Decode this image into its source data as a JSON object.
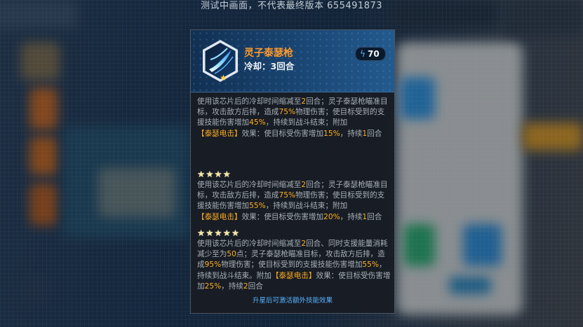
{
  "watermark": "测试中画面，不代表最终版本 655491873",
  "skill": {
    "name": "灵子泰瑟枪",
    "cooldown": "冷却：3回合",
    "cost": "70",
    "icon": "energy-spear-hexagon-icon"
  },
  "tiers": [
    {
      "stars": "",
      "parts": [
        [
          "使用该芯片后的冷却时间缩减至",
          "n"
        ],
        [
          "2",
          "h"
        ],
        [
          "回合；灵子泰瑟枪瞄准目标，攻击敌方后排，造成",
          "n"
        ],
        [
          "75%",
          "h"
        ],
        [
          "物理伤害；使目标受到的支援技能伤害增加",
          "n"
        ],
        [
          "45%",
          "h"
        ],
        [
          "，持续到战斗结束；附加",
          "n"
        ],
        [
          "【泰瑟电击】",
          "e"
        ],
        [
          "效果：使目标受伤害增加",
          "n"
        ],
        [
          "15%",
          "h"
        ],
        [
          "，持续",
          "n"
        ],
        [
          "1",
          "h"
        ],
        [
          "回合",
          "n"
        ]
      ]
    },
    {
      "stars": "★★★★",
      "parts": [
        [
          "使用该芯片后的冷却时间缩减至",
          "n"
        ],
        [
          "2",
          "h"
        ],
        [
          "回合；灵子泰瑟枪瞄准目标，攻击敌方后排，造成",
          "n"
        ],
        [
          "75%",
          "h"
        ],
        [
          "物理伤害；使目标受到的支援技能伤害增加",
          "n"
        ],
        [
          "55%",
          "h"
        ],
        [
          "，持续到战斗结束；附加",
          "n"
        ],
        [
          "【泰瑟电击】",
          "e"
        ],
        [
          "效果：使目标受伤害增加",
          "n"
        ],
        [
          "20%",
          "h"
        ],
        [
          "，持续",
          "n"
        ],
        [
          "1",
          "h"
        ],
        [
          "回合",
          "n"
        ]
      ]
    },
    {
      "stars": "★★★★★",
      "parts": [
        [
          "使用该芯片后的冷却时间缩减至",
          "n"
        ],
        [
          "2",
          "h"
        ],
        [
          "回合、同时支援能量消耗减少至为",
          "n"
        ],
        [
          "50",
          "h"
        ],
        [
          "点；灵子泰瑟枪瞄准目标，攻击敌方后排，造成",
          "n"
        ],
        [
          "95%",
          "h"
        ],
        [
          "物理伤害；使目标受到的支援技能伤害增加",
          "n"
        ],
        [
          "55%",
          "h"
        ],
        [
          "，持续到战斗结束。附加",
          "n"
        ],
        [
          "【泰瑟电击】",
          "e"
        ],
        [
          "效果：使目标受伤害增加",
          "n"
        ],
        [
          "25%",
          "h"
        ],
        [
          "，持续",
          "n"
        ],
        [
          "2",
          "h"
        ],
        [
          "回合",
          "n"
        ]
      ]
    }
  ],
  "footer_note": "升星后可激活额外技能效果",
  "colors": {
    "skill_name": "#ff9a2a",
    "highlight": "#ffae1e",
    "body_text": "#a9b0b8",
    "footer": "#5ab3ff"
  }
}
